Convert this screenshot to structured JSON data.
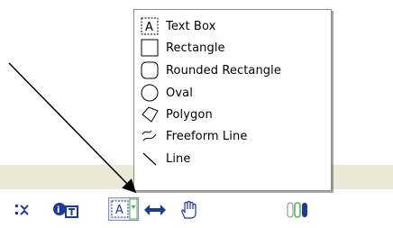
{
  "menu": {
    "items": [
      {
        "label": "Text Box",
        "icon": "text-box-icon"
      },
      {
        "label": "Rectangle",
        "icon": "rectangle-icon"
      },
      {
        "label": "Rounded Rectangle",
        "icon": "rounded-rectangle-icon"
      },
      {
        "label": "Oval",
        "icon": "oval-icon"
      },
      {
        "label": "Polygon",
        "icon": "polygon-icon"
      },
      {
        "label": "Freeform Line",
        "icon": "freeform-line-icon"
      },
      {
        "label": "Line",
        "icon": "line-icon"
      }
    ]
  },
  "toolbar": {
    "text_tool_glyph": "A",
    "buttons": [
      "list-icon",
      "insert-text-icon",
      "text-box-tool-icon",
      "dropdown-arrow-icon",
      "move-arrows-icon",
      "hand-icon",
      "battery-icon"
    ]
  },
  "colors": {
    "toolbar_blue": "#1b3d8f",
    "dropdown_green": "#49b34a",
    "menu_border": "#8a8a8a",
    "strip": "#ece9d8"
  }
}
